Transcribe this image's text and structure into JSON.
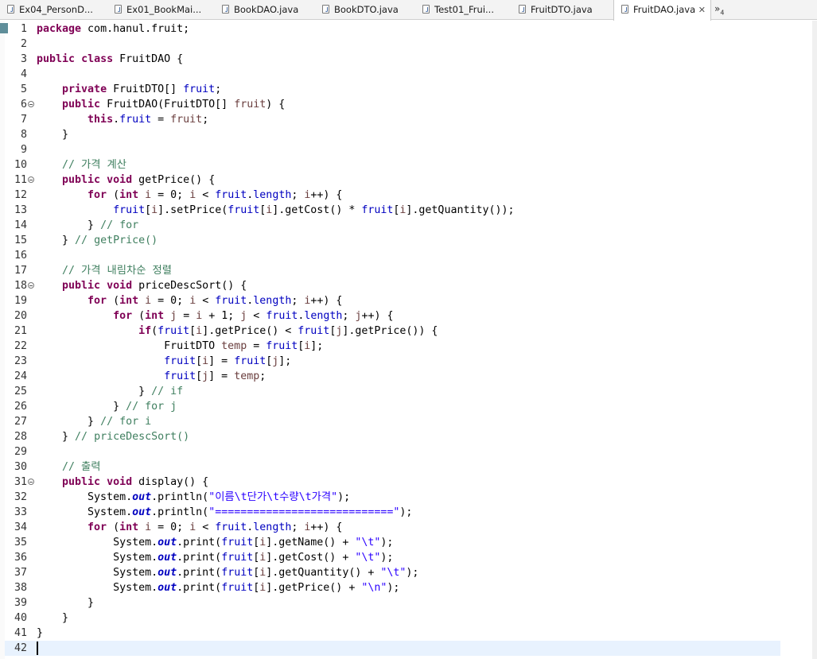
{
  "tabs": [
    {
      "label": "Ex04_PersonD...",
      "active": false
    },
    {
      "label": "Ex01_BookMai...",
      "active": false
    },
    {
      "label": "BookDAO.java",
      "active": false
    },
    {
      "label": "BookDTO.java",
      "active": false
    },
    {
      "label": "Test01_Frui...",
      "active": false
    },
    {
      "label": "FruitDTO.java",
      "active": false
    },
    {
      "label": "FruitDAO.java",
      "active": true
    }
  ],
  "tab_close": "✕",
  "tab_overflow": {
    "symbol": "»",
    "count": "4"
  },
  "colors": {
    "keyword": "#7f0055",
    "field": "#0000c0",
    "comment": "#3f7f5f",
    "string": "#2a00ff",
    "local_var": "#6a3e3e",
    "current_line": "#e8f2fe"
  },
  "editor": {
    "current_line": 42,
    "fold_lines": [
      6,
      11,
      18,
      31
    ],
    "lines": [
      [
        {
          "t": "package",
          "c": "kw"
        },
        {
          "t": " com.hanul.fruit;"
        }
      ],
      [],
      [
        {
          "t": "public",
          "c": "kw"
        },
        {
          "t": " "
        },
        {
          "t": "class",
          "c": "kw"
        },
        {
          "t": " FruitDAO {"
        }
      ],
      [],
      [
        {
          "t": "    "
        },
        {
          "t": "private",
          "c": "kw"
        },
        {
          "t": " FruitDTO[] "
        },
        {
          "t": "fruit",
          "c": "fd"
        },
        {
          "t": ";"
        }
      ],
      [
        {
          "t": "    "
        },
        {
          "t": "public",
          "c": "kw"
        },
        {
          "t": " FruitDAO(FruitDTO[] "
        },
        {
          "t": "fruit",
          "c": "lv"
        },
        {
          "t": ") {"
        }
      ],
      [
        {
          "t": "        "
        },
        {
          "t": "this",
          "c": "kw"
        },
        {
          "t": "."
        },
        {
          "t": "fruit",
          "c": "fd"
        },
        {
          "t": " = "
        },
        {
          "t": "fruit",
          "c": "lv"
        },
        {
          "t": ";"
        }
      ],
      [
        {
          "t": "    }"
        }
      ],
      [],
      [
        {
          "t": "    "
        },
        {
          "t": "// 가격 계산",
          "c": "cm"
        }
      ],
      [
        {
          "t": "    "
        },
        {
          "t": "public",
          "c": "kw"
        },
        {
          "t": " "
        },
        {
          "t": "void",
          "c": "kw"
        },
        {
          "t": " getPrice() {"
        }
      ],
      [
        {
          "t": "        "
        },
        {
          "t": "for",
          "c": "kw"
        },
        {
          "t": " ("
        },
        {
          "t": "int",
          "c": "kw"
        },
        {
          "t": " "
        },
        {
          "t": "i",
          "c": "lv"
        },
        {
          "t": " = 0; "
        },
        {
          "t": "i",
          "c": "lv"
        },
        {
          "t": " < "
        },
        {
          "t": "fruit",
          "c": "fd"
        },
        {
          "t": "."
        },
        {
          "t": "length",
          "c": "fd"
        },
        {
          "t": "; "
        },
        {
          "t": "i",
          "c": "lv"
        },
        {
          "t": "++) {"
        }
      ],
      [
        {
          "t": "            "
        },
        {
          "t": "fruit",
          "c": "fd"
        },
        {
          "t": "["
        },
        {
          "t": "i",
          "c": "lv"
        },
        {
          "t": "].setPrice("
        },
        {
          "t": "fruit",
          "c": "fd"
        },
        {
          "t": "["
        },
        {
          "t": "i",
          "c": "lv"
        },
        {
          "t": "].getCost() * "
        },
        {
          "t": "fruit",
          "c": "fd"
        },
        {
          "t": "["
        },
        {
          "t": "i",
          "c": "lv"
        },
        {
          "t": "].getQuantity());"
        }
      ],
      [
        {
          "t": "        } "
        },
        {
          "t": "// for",
          "c": "cm"
        }
      ],
      [
        {
          "t": "    } "
        },
        {
          "t": "// getPrice()",
          "c": "cm"
        }
      ],
      [],
      [
        {
          "t": "    "
        },
        {
          "t": "// 가격 내림차순 정렬",
          "c": "cm"
        }
      ],
      [
        {
          "t": "    "
        },
        {
          "t": "public",
          "c": "kw"
        },
        {
          "t": " "
        },
        {
          "t": "void",
          "c": "kw"
        },
        {
          "t": " priceDescSort() {"
        }
      ],
      [
        {
          "t": "        "
        },
        {
          "t": "for",
          "c": "kw"
        },
        {
          "t": " ("
        },
        {
          "t": "int",
          "c": "kw"
        },
        {
          "t": " "
        },
        {
          "t": "i",
          "c": "lv"
        },
        {
          "t": " = 0; "
        },
        {
          "t": "i",
          "c": "lv"
        },
        {
          "t": " < "
        },
        {
          "t": "fruit",
          "c": "fd"
        },
        {
          "t": "."
        },
        {
          "t": "length",
          "c": "fd"
        },
        {
          "t": "; "
        },
        {
          "t": "i",
          "c": "lv"
        },
        {
          "t": "++) {"
        }
      ],
      [
        {
          "t": "            "
        },
        {
          "t": "for",
          "c": "kw"
        },
        {
          "t": " ("
        },
        {
          "t": "int",
          "c": "kw"
        },
        {
          "t": " "
        },
        {
          "t": "j",
          "c": "lv"
        },
        {
          "t": " = "
        },
        {
          "t": "i",
          "c": "lv"
        },
        {
          "t": " + 1; "
        },
        {
          "t": "j",
          "c": "lv"
        },
        {
          "t": " < "
        },
        {
          "t": "fruit",
          "c": "fd"
        },
        {
          "t": "."
        },
        {
          "t": "length",
          "c": "fd"
        },
        {
          "t": "; "
        },
        {
          "t": "j",
          "c": "lv"
        },
        {
          "t": "++) {"
        }
      ],
      [
        {
          "t": "                "
        },
        {
          "t": "if",
          "c": "kw"
        },
        {
          "t": "("
        },
        {
          "t": "fruit",
          "c": "fd"
        },
        {
          "t": "["
        },
        {
          "t": "i",
          "c": "lv"
        },
        {
          "t": "].getPrice() < "
        },
        {
          "t": "fruit",
          "c": "fd"
        },
        {
          "t": "["
        },
        {
          "t": "j",
          "c": "lv"
        },
        {
          "t": "].getPrice()) {"
        }
      ],
      [
        {
          "t": "                    FruitDTO "
        },
        {
          "t": "temp",
          "c": "lv"
        },
        {
          "t": " = "
        },
        {
          "t": "fruit",
          "c": "fd"
        },
        {
          "t": "["
        },
        {
          "t": "i",
          "c": "lv"
        },
        {
          "t": "];"
        }
      ],
      [
        {
          "t": "                    "
        },
        {
          "t": "fruit",
          "c": "fd"
        },
        {
          "t": "["
        },
        {
          "t": "i",
          "c": "lv"
        },
        {
          "t": "] = "
        },
        {
          "t": "fruit",
          "c": "fd"
        },
        {
          "t": "["
        },
        {
          "t": "j",
          "c": "lv"
        },
        {
          "t": "];"
        }
      ],
      [
        {
          "t": "                    "
        },
        {
          "t": "fruit",
          "c": "fd"
        },
        {
          "t": "["
        },
        {
          "t": "j",
          "c": "lv"
        },
        {
          "t": "] = "
        },
        {
          "t": "temp",
          "c": "lv"
        },
        {
          "t": ";"
        }
      ],
      [
        {
          "t": "                } "
        },
        {
          "t": "// if",
          "c": "cm"
        }
      ],
      [
        {
          "t": "            } "
        },
        {
          "t": "// for j",
          "c": "cm"
        }
      ],
      [
        {
          "t": "        } "
        },
        {
          "t": "// for i",
          "c": "cm"
        }
      ],
      [
        {
          "t": "    } "
        },
        {
          "t": "// priceDescSort()",
          "c": "cm"
        }
      ],
      [],
      [
        {
          "t": "    "
        },
        {
          "t": "// 출력",
          "c": "cm"
        }
      ],
      [
        {
          "t": "    "
        },
        {
          "t": "public",
          "c": "kw"
        },
        {
          "t": " "
        },
        {
          "t": "void",
          "c": "kw"
        },
        {
          "t": " display() {"
        }
      ],
      [
        {
          "t": "        System."
        },
        {
          "t": "out",
          "c": "st"
        },
        {
          "t": ".println("
        },
        {
          "t": "\"이름\\t단가\\t수량\\t가격\"",
          "c": "s"
        },
        {
          "t": ");"
        }
      ],
      [
        {
          "t": "        System."
        },
        {
          "t": "out",
          "c": "st"
        },
        {
          "t": ".println("
        },
        {
          "t": "\"============================\"",
          "c": "s"
        },
        {
          "t": ");"
        }
      ],
      [
        {
          "t": "        "
        },
        {
          "t": "for",
          "c": "kw"
        },
        {
          "t": " ("
        },
        {
          "t": "int",
          "c": "kw"
        },
        {
          "t": " "
        },
        {
          "t": "i",
          "c": "lv"
        },
        {
          "t": " = 0; "
        },
        {
          "t": "i",
          "c": "lv"
        },
        {
          "t": " < "
        },
        {
          "t": "fruit",
          "c": "fd"
        },
        {
          "t": "."
        },
        {
          "t": "length",
          "c": "fd"
        },
        {
          "t": "; "
        },
        {
          "t": "i",
          "c": "lv"
        },
        {
          "t": "++) {"
        }
      ],
      [
        {
          "t": "            System."
        },
        {
          "t": "out",
          "c": "st"
        },
        {
          "t": ".print("
        },
        {
          "t": "fruit",
          "c": "fd"
        },
        {
          "t": "["
        },
        {
          "t": "i",
          "c": "lv"
        },
        {
          "t": "].getName() + "
        },
        {
          "t": "\"\\t\"",
          "c": "s"
        },
        {
          "t": ");"
        }
      ],
      [
        {
          "t": "            System."
        },
        {
          "t": "out",
          "c": "st"
        },
        {
          "t": ".print("
        },
        {
          "t": "fruit",
          "c": "fd"
        },
        {
          "t": "["
        },
        {
          "t": "i",
          "c": "lv"
        },
        {
          "t": "].getCost() + "
        },
        {
          "t": "\"\\t\"",
          "c": "s"
        },
        {
          "t": ");"
        }
      ],
      [
        {
          "t": "            System."
        },
        {
          "t": "out",
          "c": "st"
        },
        {
          "t": ".print("
        },
        {
          "t": "fruit",
          "c": "fd"
        },
        {
          "t": "["
        },
        {
          "t": "i",
          "c": "lv"
        },
        {
          "t": "].getQuantity() + "
        },
        {
          "t": "\"\\t\"",
          "c": "s"
        },
        {
          "t": ");"
        }
      ],
      [
        {
          "t": "            System."
        },
        {
          "t": "out",
          "c": "st"
        },
        {
          "t": ".print("
        },
        {
          "t": "fruit",
          "c": "fd"
        },
        {
          "t": "["
        },
        {
          "t": "i",
          "c": "lv"
        },
        {
          "t": "].getPrice() + "
        },
        {
          "t": "\"\\n\"",
          "c": "s"
        },
        {
          "t": ");"
        }
      ],
      [
        {
          "t": "        }"
        }
      ],
      [
        {
          "t": "    }"
        }
      ],
      [
        {
          "t": "}"
        }
      ],
      []
    ]
  }
}
